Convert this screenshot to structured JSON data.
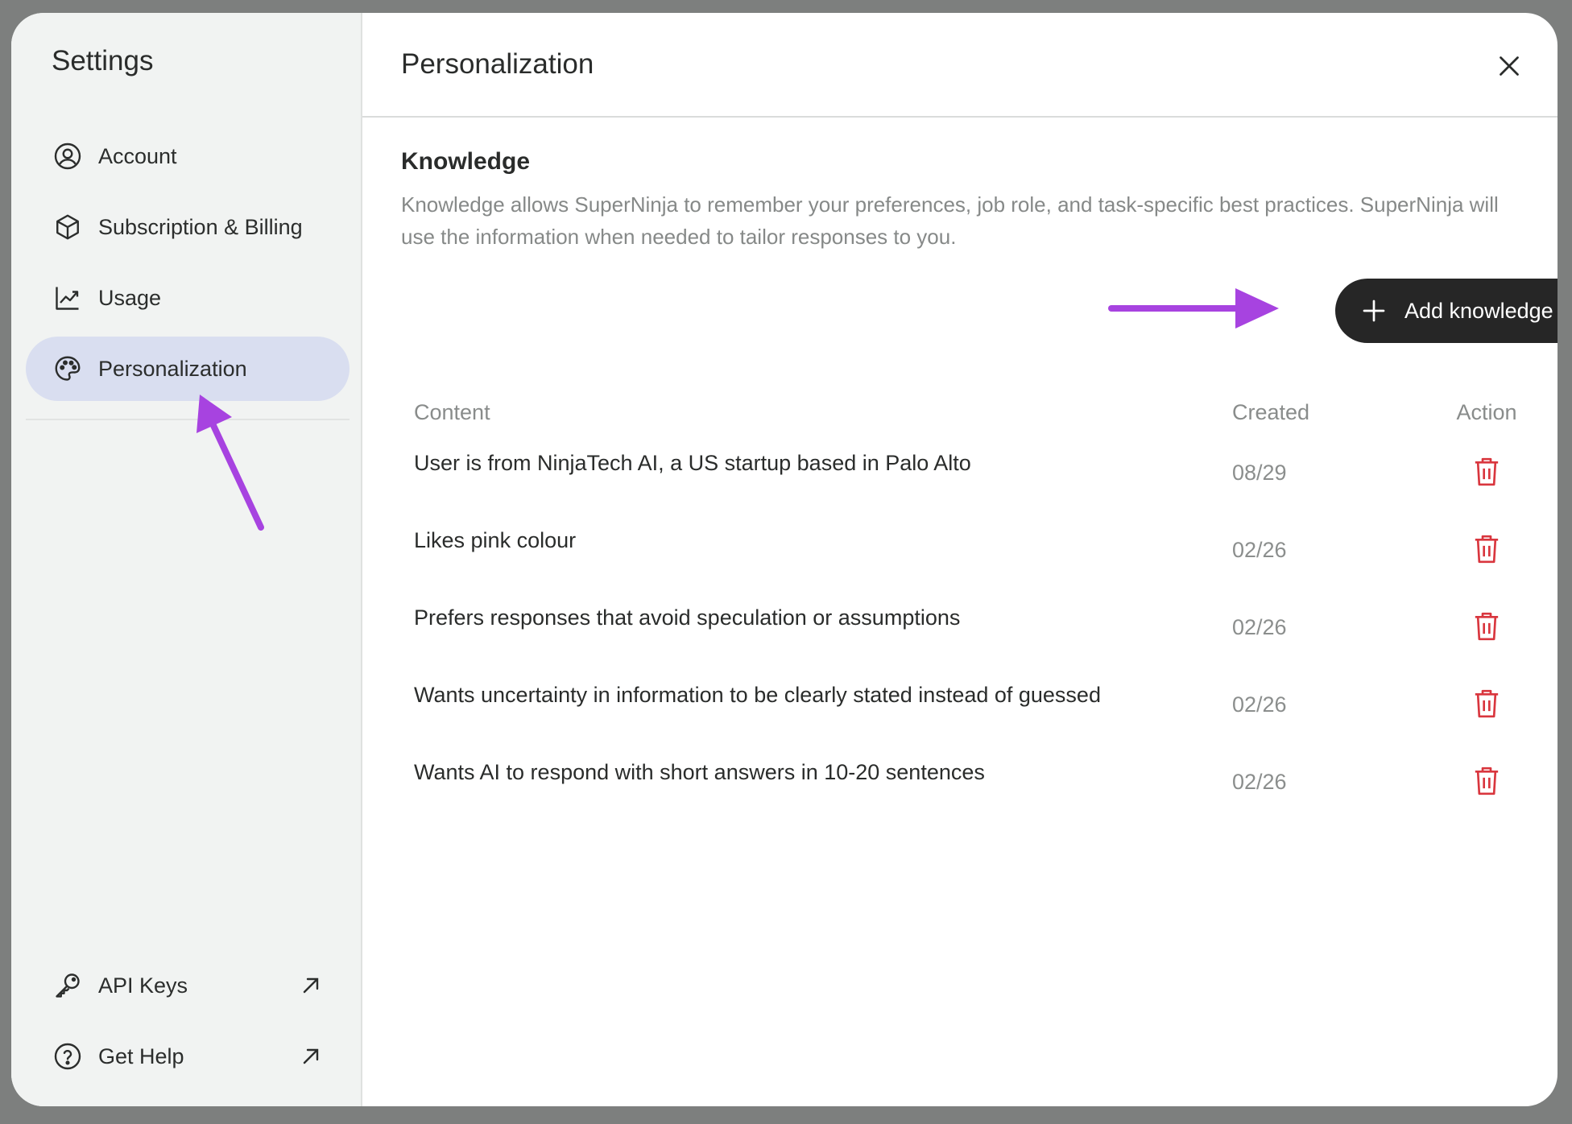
{
  "sidebar": {
    "title": "Settings",
    "items": [
      {
        "label": "Account",
        "icon": "account-circle-icon"
      },
      {
        "label": "Subscription & Billing",
        "icon": "cube-icon"
      },
      {
        "label": "Usage",
        "icon": "chart-line-icon"
      },
      {
        "label": "Personalization",
        "icon": "palette-icon",
        "active": true
      }
    ],
    "bottom_items": [
      {
        "label": "API Keys",
        "icon": "key-icon",
        "trailing_icon": "external-arrow-icon"
      },
      {
        "label": "Get Help",
        "icon": "question-circle-icon",
        "trailing_icon": "external-arrow-icon"
      }
    ]
  },
  "main": {
    "title": "Personalization",
    "close_icon": "close-icon",
    "section": {
      "title": "Knowledge",
      "description": "Knowledge allows SuperNinja to remember your preferences, job role, and task-specific best practices. SuperNinja will use the information when needed to tailor responses to you."
    },
    "add_button_label": "Add knowledge",
    "table": {
      "headers": [
        "Content",
        "Created",
        "Action"
      ],
      "rows": [
        {
          "content": "User is from NinjaTech AI, a US startup based in Palo Alto",
          "created": "08/29"
        },
        {
          "content": "Likes pink colour",
          "created": "02/26"
        },
        {
          "content": "Prefers responses that avoid speculation or assumptions",
          "created": "02/26"
        },
        {
          "content": "Wants uncertainty in information to be clearly stated instead of guessed",
          "created": "02/26"
        },
        {
          "content": "Wants AI to respond with short answers in 10-20 sentences",
          "created": "02/26"
        }
      ]
    }
  },
  "colors": {
    "active_nav_bg": "#d9def0",
    "button_bg": "#262626",
    "trash_red": "#d9363e",
    "annotation_purple": "#a743e0"
  }
}
